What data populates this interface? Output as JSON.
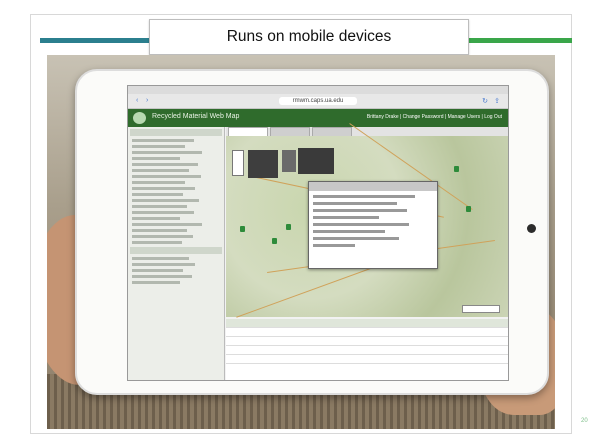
{
  "slide": {
    "title": "Runs on mobile devices",
    "page_number": "20",
    "colors": {
      "left_bar": "#2b7f8e",
      "right_bar": "#3aa64a",
      "app_header": "#2f6b2c"
    }
  },
  "photo": {
    "browser": {
      "status_time": "",
      "url": "rmwm.caps.ua.edu"
    },
    "app": {
      "title": "Recycled Material Web Map",
      "user_links": "Brittany Drake | Change Password | Manage Users | Log Out"
    }
  }
}
